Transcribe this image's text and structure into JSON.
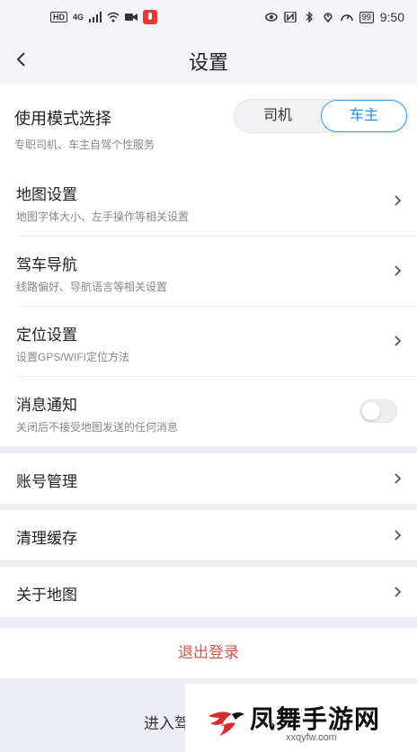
{
  "status_bar": {
    "left": {
      "hd": "HD",
      "signal": "4G"
    },
    "right": {
      "battery": "99",
      "time": "9:50"
    }
  },
  "header": {
    "title": "设置"
  },
  "mode": {
    "title": "使用模式选择",
    "subtitle": "专职司机、车主自驾个性服务",
    "options": [
      "司机",
      "车主"
    ],
    "selected": "车主"
  },
  "items": [
    {
      "title": "地图设置",
      "subtitle": "地图字体大小、左手操作等相关设置"
    },
    {
      "title": "驾车导航",
      "subtitle": "线路偏好、导航语言等相关设置"
    },
    {
      "title": "定位设置",
      "subtitle": "设置GPS/WIFI定位方法"
    },
    {
      "title": "消息通知",
      "subtitle": "关闭后不接受地图发送的任何消息",
      "toggle_on": false
    }
  ],
  "single_items": [
    "账号管理",
    "清理缓存",
    "关于地图"
  ],
  "logout": "退出登录",
  "bottom": {
    "partial_text": "进入驾"
  },
  "watermark": {
    "name": "凤舞手游网",
    "url": "xxqyfw.com"
  },
  "colors": {
    "accent": "#1f8ee0",
    "logout": "#d9534f",
    "background": "#ecedf5"
  }
}
